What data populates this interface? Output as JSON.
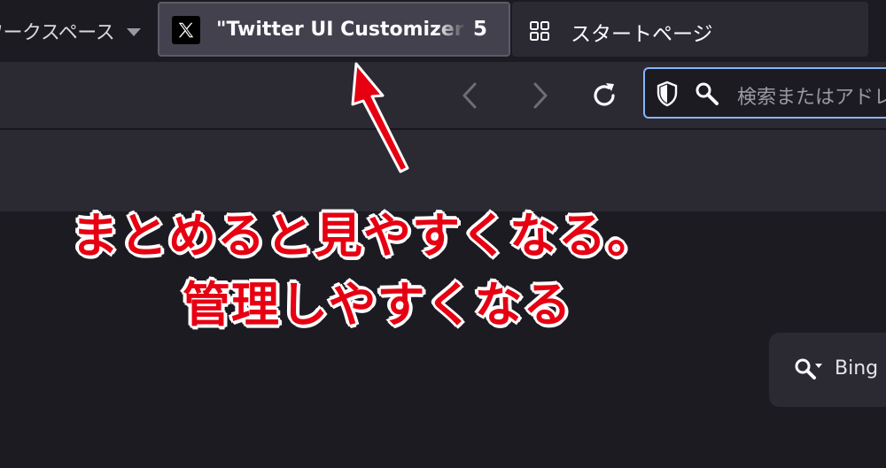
{
  "workspace": {
    "label": "ワークスペース"
  },
  "tabs": [
    {
      "title": "\"Twitter UI Customizer\"",
      "count": "5",
      "icon": "x-logo-icon",
      "active": true
    },
    {
      "title": "スタートページ",
      "icon": "grid-icon",
      "active": false
    }
  ],
  "urlbar": {
    "placeholder": "検索またはアドレスを入力"
  },
  "content": {
    "search_label": "Bing"
  },
  "annotation": {
    "line1": "まとめると見やすくなる。",
    "line2": "管理しやすくなる"
  },
  "colors": {
    "annotation": "#e60012",
    "active_tab": "#42414d",
    "focus_ring": "#8ab4f8"
  }
}
